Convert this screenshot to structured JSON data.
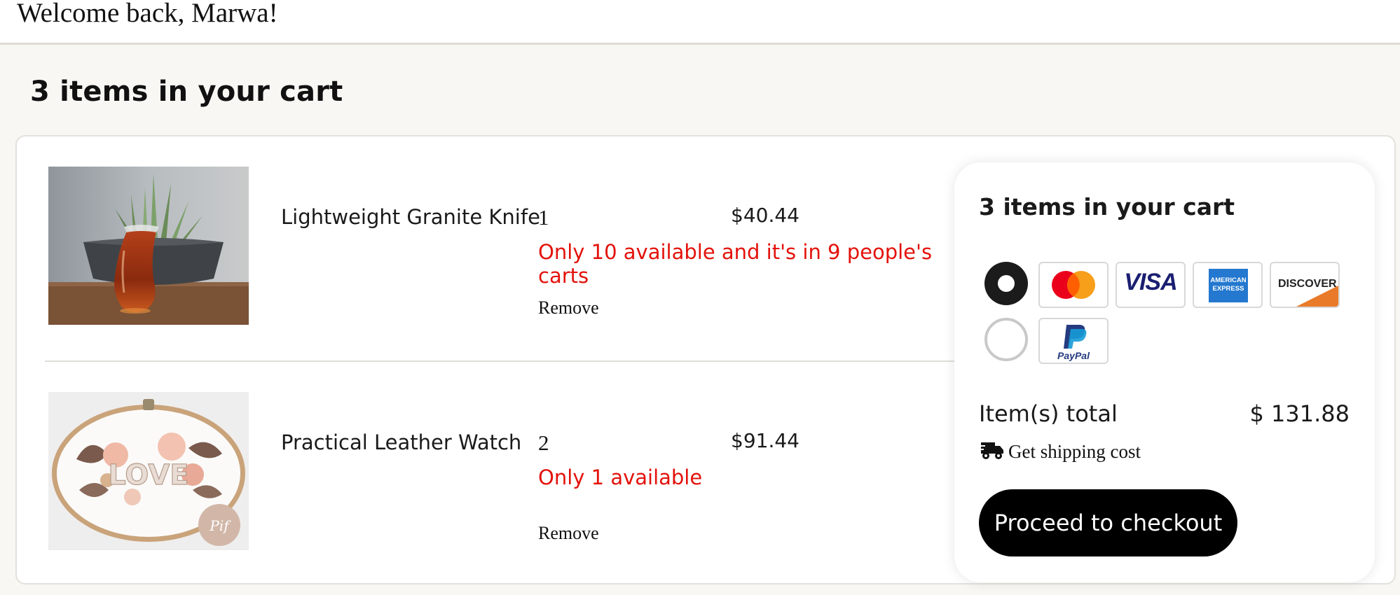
{
  "header": {
    "welcome_text": "Welcome back, Marwa!"
  },
  "cart": {
    "title": "3 items in your cart",
    "items": [
      {
        "name": "Lightweight Granite Knife",
        "quantity": "1",
        "price": "$40.44",
        "stock_warning": "Only 10 available and it's in 9 people's carts",
        "remove_label": "Remove",
        "image": "tea-glass-photo"
      },
      {
        "name": "Practical Leather Watch",
        "quantity": "2",
        "price": "$91.44",
        "stock_warning": "Only 1 available",
        "remove_label": "Remove",
        "image": "embroidery-hoop-love-photo"
      }
    ]
  },
  "summary": {
    "title": "3 items in your cart",
    "payment_methods": {
      "cards_group": {
        "selected": true,
        "cards": [
          "mastercard",
          "visa",
          "american-express",
          "discover"
        ]
      },
      "paypal_group": {
        "selected": false,
        "label": "PayPal"
      },
      "visa_label": "VISA",
      "amex_label_1": "AMERICAN",
      "amex_label_2": "EXPRESS",
      "discover_label": "DISCOVER"
    },
    "total_label": "Item(s) total",
    "total_value": "$ 131.88",
    "shipping_label": "Get shipping cost",
    "checkout_label": "Proceed to checkout"
  },
  "colors": {
    "warning": "#e3120b",
    "checkout_button_bg": "#000000",
    "page_background": "#f8f7f4"
  }
}
